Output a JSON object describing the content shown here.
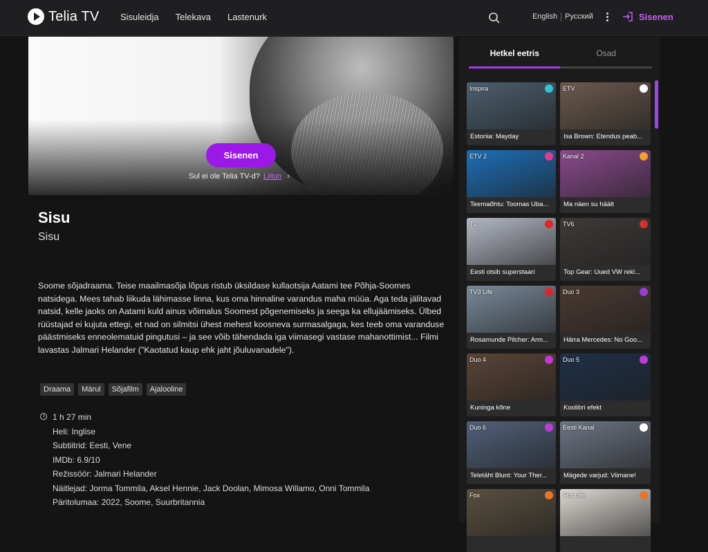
{
  "header": {
    "brand": "Telia TV",
    "nav": [
      "Sisuleidja",
      "Telekava",
      "Lastenurk"
    ],
    "lang_en": "English",
    "lang_ru": "Русский",
    "login": "Sisenen",
    "accent": "#c45df3"
  },
  "hero": {
    "button": "Sisenen",
    "note": "Sul ei ole Telia TV-d?",
    "note_link": "Liitun",
    "button_color": "#9b19e6"
  },
  "movie": {
    "title": "Sisu",
    "subtitle": "Sisu",
    "description": "Soome sõjadraama. Teise maailmasõja lõpus ristub üksildase kullaotsija Aatami tee Põhja-Soomes natsidega. Mees tahab liikuda lähimasse linna, kus oma hinnaline varandus maha müüa. Aga teda jälitavad natsid, kelle jaoks on Aatami kuld ainus võimalus Soomest põgenemiseks ja seega ka ellujäämiseks. Ülbed rüüstajad ei kujuta ettegi, et nad on silmitsi ühest mehest koosneva surmasalgaga, kes teeb oma varanduse päästmiseks enneolematuid pingutusi – ja see võib tähendada iga viimasegi vastase mahanottimist... Filmi lavastas Jalmari Helander (\"Kaotatud kaup ehk jaht jõuluvanadele\").",
    "tags": [
      "Draama",
      "Märul",
      "Sõjafilm",
      "Ajalooline"
    ],
    "duration": "1 h 27 min",
    "audio": "Heli: Inglise",
    "subtitles": "Subtiitrid: Eesti, Vene",
    "imdb": "IMDb: 6.9/10",
    "director": "Režissöör: Jalmari Helander",
    "cast": "Näitlejad: Jorma Tommila, Aksel Hennie, Jack Doolan, Mimosa Willamo, Onni Tommila",
    "origin": "Päritolumaa: 2022, Soome, Suurbritannia"
  },
  "sidebar": {
    "tabs": [
      "Hetkel eetris",
      "Osad"
    ],
    "cards": [
      {
        "channel": "Inspira",
        "title": "Estonia: Mayday",
        "bg": "#4c5f6e",
        "logo": "#2ec4d6"
      },
      {
        "channel": "ETV",
        "title": "Isa Brown: Etendus peab...",
        "bg": "#6b5a4e",
        "logo": "#ffffff"
      },
      {
        "channel": "ETV 2",
        "title": "Teemaõhtu: Toomas Uba...",
        "bg": "#1d6fb8",
        "logo": "#e33a8f"
      },
      {
        "channel": "Kanal 2",
        "title": "Ma näen su häält",
        "bg": "#8a4a8e",
        "logo": "#f0a12b"
      },
      {
        "channel": "TV3",
        "title": "Eesti otsib superstaari",
        "bg": "#b4b9c4",
        "logo": "#e0242c"
      },
      {
        "channel": "TV6",
        "title": "Top Gear: Uued VW rekl...",
        "bg": "#3d3a38",
        "logo": "#d32f2f"
      },
      {
        "channel": "TV3 Life",
        "title": "Rosamunde Pilcher: Arm...",
        "bg": "#7a8a9a",
        "logo": "#e0242c"
      },
      {
        "channel": "Duo 3",
        "title": "Härra Mercedes: No Goo...",
        "bg": "#4a3a32",
        "logo": "#9c3cd6"
      },
      {
        "channel": "Duo 4",
        "title": "Kuninga kõne",
        "bg": "#5a4436",
        "logo": "#c03bd6"
      },
      {
        "channel": "Duo 5",
        "title": "Koolibri efekt",
        "bg": "#1e3048",
        "logo": "#c03bd6"
      },
      {
        "channel": "Duo 6",
        "title": "Teletäht Blunt: Your Ther...",
        "bg": "#51607a",
        "logo": "#c03bd6"
      },
      {
        "channel": "Eesti Kanal",
        "title": "Mägede varjud: Viimane!",
        "bg": "#6e7684",
        "logo": "#ffffff"
      },
      {
        "channel": "Fox",
        "title": "",
        "bg": "#5a5040",
        "logo": "#e8732a"
      },
      {
        "channel": "Fox Life",
        "title": "",
        "bg": "#ddd8d2",
        "logo": "#e8732a"
      }
    ]
  }
}
